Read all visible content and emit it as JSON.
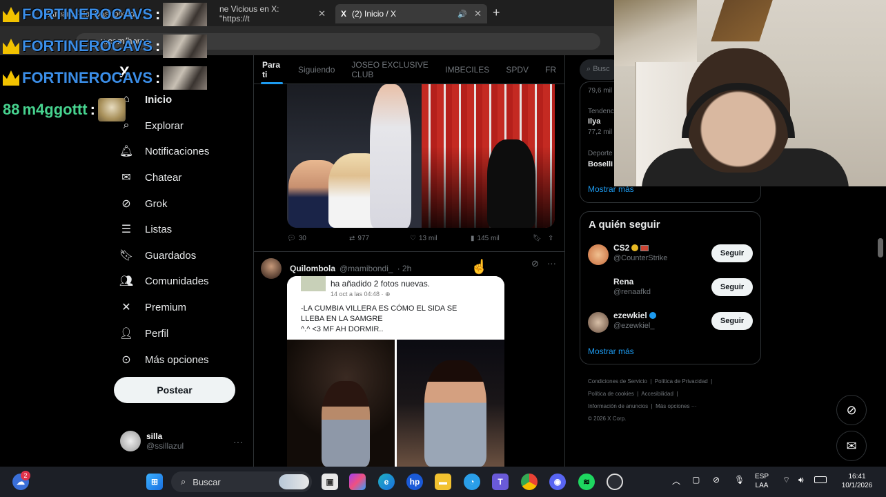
{
  "browser": {
    "tabs": [
      {
        "label": "Stream Pilot Dashboard"
      },
      {
        "label": "ne Vicious en X: \"https://t"
      },
      {
        "label": "(2) Inicio / X"
      }
    ],
    "url": "x.com/home"
  },
  "chat_overlay": [
    {
      "name": "FORTINEROCAVS",
      "colon": ":"
    },
    {
      "name": "FORTINEROCAVS",
      "colon": ":"
    },
    {
      "name": "FORTINEROCAVS",
      "colon": ":"
    },
    {
      "name": "m4ggottt",
      "colon": ":"
    }
  ],
  "nav": {
    "logo": "X",
    "items": [
      {
        "label": "Inicio",
        "icon": "home-icon"
      },
      {
        "label": "Explorar",
        "icon": "search-icon"
      },
      {
        "label": "Notificaciones",
        "icon": "bell-icon"
      },
      {
        "label": "Chatear",
        "icon": "mail-icon"
      },
      {
        "label": "Grok",
        "icon": "grok-icon"
      },
      {
        "label": "Listas",
        "icon": "list-icon"
      },
      {
        "label": "Guardados",
        "icon": "bookmark-icon"
      },
      {
        "label": "Comunidades",
        "icon": "people-icon"
      },
      {
        "label": "Premium",
        "icon": "x-icon"
      },
      {
        "label": "Perfil",
        "icon": "person-icon"
      },
      {
        "label": "Más opciones",
        "icon": "more-icon"
      }
    ],
    "post_button": "Postear",
    "profile": {
      "name": "silla",
      "handle": "@ssillazul"
    }
  },
  "timeline": {
    "tabs": [
      "Para ti",
      "Siguiendo",
      "JOSEO EXCLUSIVE CLUB",
      "IMBECILES",
      "SPDV",
      "FR"
    ],
    "tweet1_actions": {
      "replies": "30",
      "reposts": "977",
      "likes": "13 mil",
      "views": "145 mil"
    },
    "tweet2": {
      "name": "Quilombola",
      "handle": "@mamibondi_",
      "time": "· 2h",
      "post_header": "ha añadido 2 fotos nuevas.",
      "post_date": "14 oct a las 04:48 · ⊕",
      "post_text_line1": "-LA CUMBIA VILLERA ES CÓMO EL SIDA SE",
      "post_text_line2": "LLEBA EN LA SAMGRE",
      "post_text_line3": "^.^ <3 MF AH DORMIR.."
    }
  },
  "right": {
    "search_placeholder": "Busc",
    "trends": [
      {
        "meta": "79,6 mil"
      },
      {
        "meta": "Tendencia",
        "title": "Ilya",
        "count": "77,2 mil"
      },
      {
        "meta": "Deporte",
        "title": "Boselli"
      }
    ],
    "trends_more": "Mostrar más",
    "follow_title": "A quién seguir",
    "follow": [
      {
        "name": "CS2",
        "handle": "@CounterStrike",
        "button": "Seguir"
      },
      {
        "name": "Rena",
        "handle": "@renaafkd",
        "button": "Seguir"
      },
      {
        "name": "ezewkiel",
        "handle": "@ezewkiel_",
        "button": "Seguir"
      }
    ],
    "follow_more": "Mostrar más",
    "footer": [
      "Condiciones de Servicio",
      "Política de Privacidad",
      "Política de cookies",
      "Accesibilidad",
      "Información de anuncios",
      "Más opciones ···",
      "© 2026 X Corp."
    ]
  },
  "taskbar": {
    "search_label": "Buscar",
    "lang_line1": "ESP",
    "lang_line2": "LAA",
    "time": "16:41",
    "date": "10/1/2026",
    "notification_badge": "2"
  }
}
